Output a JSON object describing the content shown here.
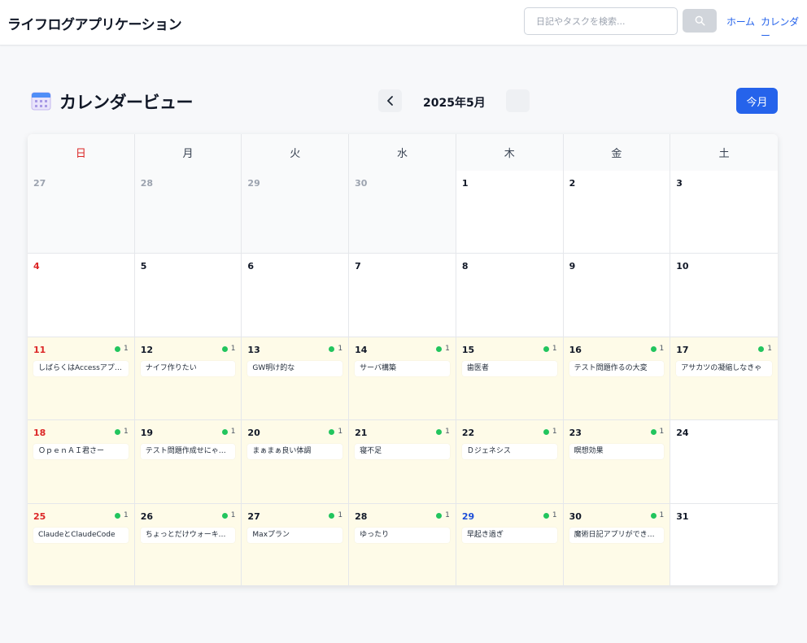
{
  "header": {
    "app_title": "ライフログアプリケーション",
    "search_placeholder": "日記やタスクを検索...",
    "nav": [
      {
        "label": "ホーム"
      },
      {
        "label": "カレンダー"
      }
    ]
  },
  "toolbar": {
    "page_title": "カレンダービュー",
    "month_label": "2025年5月",
    "today_label": "今月"
  },
  "colors": {
    "accent": "#2563eb",
    "sunday": "#dc2626",
    "entry_bg": "#fefbe8",
    "dot": "#22c55e"
  },
  "weekdays": [
    "日",
    "月",
    "火",
    "水",
    "木",
    "金",
    "土"
  ],
  "days": [
    {
      "num": "27",
      "outside": true
    },
    {
      "num": "28",
      "outside": true
    },
    {
      "num": "29",
      "outside": true
    },
    {
      "num": "30",
      "outside": true
    },
    {
      "num": "1"
    },
    {
      "num": "2"
    },
    {
      "num": "3"
    },
    {
      "num": "4",
      "sunday": true
    },
    {
      "num": "5"
    },
    {
      "num": "6"
    },
    {
      "num": "7"
    },
    {
      "num": "8"
    },
    {
      "num": "9"
    },
    {
      "num": "10"
    },
    {
      "num": "11",
      "sunday": true,
      "count": "1",
      "entry": "しばらくはAccessアプリで"
    },
    {
      "num": "12",
      "count": "1",
      "entry": "ナイフ作りたい"
    },
    {
      "num": "13",
      "count": "1",
      "entry": "GW明け的な"
    },
    {
      "num": "14",
      "count": "1",
      "entry": "サーバ構築"
    },
    {
      "num": "15",
      "count": "1",
      "entry": "歯医者"
    },
    {
      "num": "16",
      "count": "1",
      "entry": "テスト問題作るの大変"
    },
    {
      "num": "17",
      "count": "1",
      "entry": "アサカツの凝縮しなきゃ"
    },
    {
      "num": "18",
      "sunday": true,
      "count": "1",
      "entry": "ＯｐｅｎＡＩ君さー"
    },
    {
      "num": "19",
      "count": "1",
      "entry": "テスト問題作成せにゃなぁ"
    },
    {
      "num": "20",
      "count": "1",
      "entry": "まぁまぁ良い体調"
    },
    {
      "num": "21",
      "count": "1",
      "entry": "寝不足"
    },
    {
      "num": "22",
      "count": "1",
      "entry": "Ｄジェネシス"
    },
    {
      "num": "23",
      "count": "1",
      "entry": "瞑想効果"
    },
    {
      "num": "24"
    },
    {
      "num": "25",
      "sunday": true,
      "count": "1",
      "entry": "ClaudeとClaudeCode"
    },
    {
      "num": "26",
      "count": "1",
      "entry": "ちょっとだけウォーキング"
    },
    {
      "num": "27",
      "count": "1",
      "entry": "Maxプラン"
    },
    {
      "num": "28",
      "count": "1",
      "entry": "ゆったり"
    },
    {
      "num": "29",
      "holiday": true,
      "count": "1",
      "entry": "早起き過ぎ"
    },
    {
      "num": "30",
      "count": "1",
      "entry": "魔術日記アプリができた..."
    },
    {
      "num": "31"
    }
  ]
}
